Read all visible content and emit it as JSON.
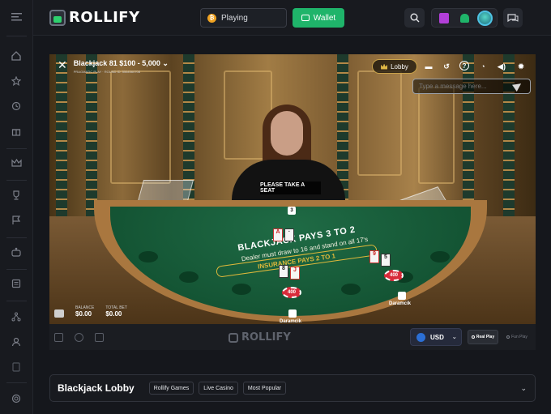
{
  "brand": {
    "name": "ROLLIFY"
  },
  "topbar": {
    "playing_label": "Playing",
    "wallet_label": "Wallet"
  },
  "game": {
    "title": "Blackjack 81 $100 - 5,000",
    "subtitle": "PRAGMATIC PLAY · ROUND ID: 5564560708",
    "lobby_label": "Lobby",
    "message_placeholder": "Type a message here...",
    "seat_label": "PLEASE TAKE A SEAT",
    "table_text": "BLACKJACK PAYS 3 TO 2",
    "table_subtext": "Dealer must draw to 16 and stand on all 17's",
    "insurance_text": "INSURANCE PAYS 2 TO 1",
    "dealer_count": "3",
    "players": [
      {
        "name": "Daramcik",
        "chip": "400",
        "count": ""
      },
      {
        "name": "Daramcik",
        "chip": "400",
        "count": ""
      }
    ],
    "balance_label": "BALANCE",
    "balance_value": "$0.00",
    "total_bet_label": "TOTAL BET",
    "total_bet_value": "$0.00"
  },
  "gamebar": {
    "logo": "ROLLIFY",
    "currency": "USD",
    "real_play": "Real Play",
    "fun_play": "Fun Play"
  },
  "lobby": {
    "title": "Blackjack Lobby",
    "tags": [
      "Rollify Games",
      "Live Casino",
      "Most Popular"
    ]
  },
  "colors": {
    "accent": "#1fb46a",
    "bg": "#15171c",
    "felt": "#1f6b45"
  },
  "icons": [
    "menu-icon",
    "home-icon",
    "star-icon",
    "history-icon",
    "gift-icon",
    "crown-icon",
    "trophy-icon",
    "flag-icon",
    "slots-icon",
    "news-icon",
    "affiliate-icon",
    "user-icon",
    "document-icon",
    "support-icon",
    "search-icon",
    "chat-icon",
    "bell-icon"
  ]
}
